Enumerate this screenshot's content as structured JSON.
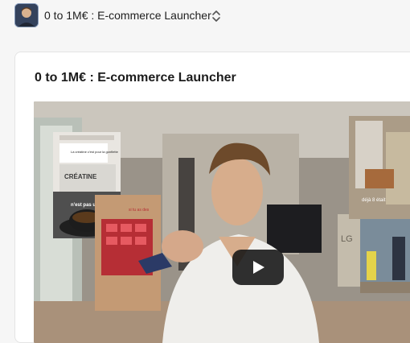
{
  "header": {
    "app_title": "0 to 1M€ : E-commerce Launcher",
    "switcher_icon": "chevron-up-down-icon",
    "avatar_icon": "user-avatar"
  },
  "course": {
    "title": "0 to 1M€ : E-commerce Launcher"
  },
  "video": {
    "play_icon": "play-icon",
    "overlay_texts": {
      "left_card_caption": "La créatine c'est pour la gonflette",
      "product_label": "CRÉATINE",
      "product_caption": "n'est pas un",
      "box_caption": "si tu as des",
      "right_top_caption": "déjà 8 était"
    },
    "tv_brand": "LG"
  },
  "colors": {
    "page_bg": "#f6f6f6",
    "card_bg": "#ffffff",
    "play_bg": "#141414"
  }
}
